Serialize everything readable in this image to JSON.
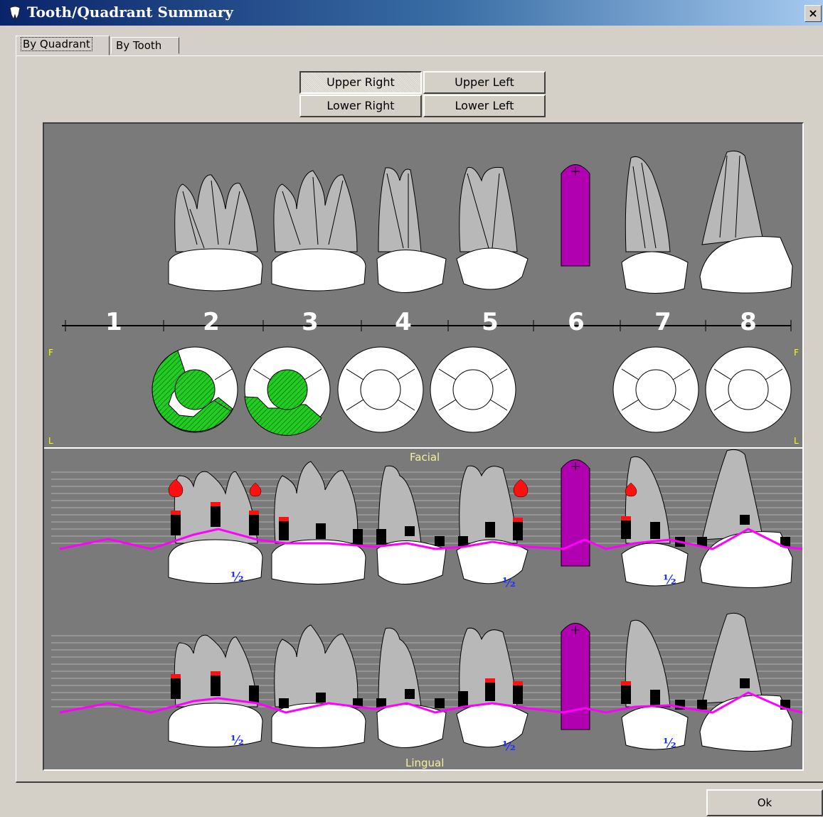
{
  "window": {
    "title": "Tooth/Quadrant Summary",
    "close_label": "×"
  },
  "tabs": [
    {
      "label": "By Quadrant",
      "active": true
    },
    {
      "label": "By Tooth",
      "active": false
    }
  ],
  "quadrants": {
    "upper_right": {
      "label": "Upper Right",
      "pressed": true
    },
    "upper_left": {
      "label": "Upper Left",
      "pressed": false
    },
    "lower_right": {
      "label": "Lower Right",
      "pressed": false
    },
    "lower_left": {
      "label": "Lower Left",
      "pressed": false
    }
  },
  "chart": {
    "tooth_numbers": [
      "1",
      "2",
      "3",
      "4",
      "5",
      "6",
      "7",
      "8"
    ],
    "surface_marks": {
      "facial": "F",
      "lingual": "L"
    },
    "facial_label": "Facial",
    "lingual_label": "Lingual",
    "half_mark": "½",
    "colors": {
      "background": "#7a7a7a",
      "implant": "#b000b0",
      "filling": "#22cc22",
      "perio_line": "#ff00ff",
      "bleeding": "#ff1010",
      "axis_numbers": "#ffffff",
      "surface_marks": "#ffff00"
    }
  },
  "ok_label": "Ok"
}
